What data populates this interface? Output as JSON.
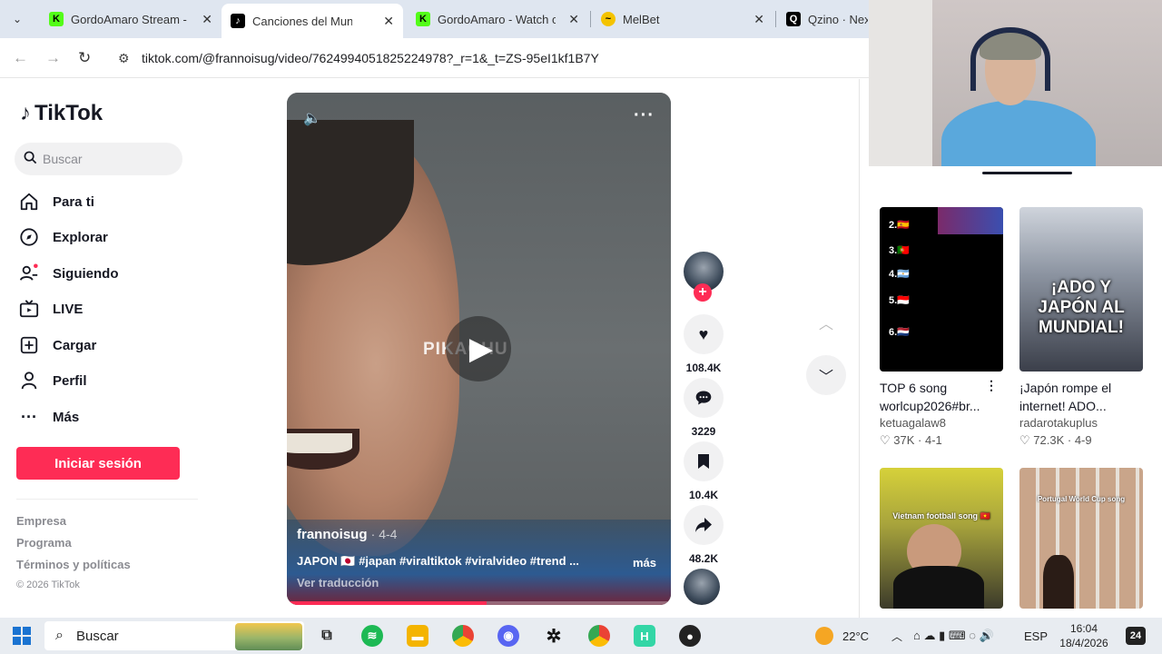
{
  "browser": {
    "tabs": [
      {
        "title": "GordoAmaro Stream - W",
        "favicon": "kick-icon",
        "color": "#53fc18"
      },
      {
        "title": "Canciones del Mundi",
        "favicon": "tiktok-icon",
        "color": "#000000"
      },
      {
        "title": "GordoAmaro - Watch cli",
        "favicon": "kick-icon",
        "color": "#53fc18"
      },
      {
        "title": "MelBet",
        "favicon": "melbet-icon",
        "color": "#f4c300"
      },
      {
        "title": "Qzino · Next-",
        "favicon": "qzino-icon",
        "color": "#000000"
      }
    ],
    "url": "tiktok.com/@frannoisug/video/7624994051825224978?_r=1&_t=ZS-95eI1kf1B7Y"
  },
  "sidebar": {
    "logo": "TikTok",
    "search_placeholder": "Buscar",
    "nav": [
      {
        "label": "Para ti",
        "icon": "home-icon"
      },
      {
        "label": "Explorar",
        "icon": "compass-icon"
      },
      {
        "label": "Siguiendo",
        "icon": "following-icon"
      },
      {
        "label": "LIVE",
        "icon": "live-tv-icon"
      },
      {
        "label": "Cargar",
        "icon": "upload-icon"
      },
      {
        "label": "Perfil",
        "icon": "profile-icon"
      },
      {
        "label": "Más",
        "icon": "more-icon"
      }
    ],
    "login_label": "Iniciar sesión",
    "footer_links": [
      "Empresa",
      "Programa",
      "Términos y políticas"
    ],
    "copyright": "© 2026 TikTok"
  },
  "video": {
    "watermark": "PIKACHU",
    "author": "frannoisug",
    "date": "· 4-4",
    "caption": "JAPON 🇯🇵 #japan #viraltiktok #viralvideo #trend ...",
    "more_label": "más",
    "translate_label": "Ver traducción",
    "progress": 0.52,
    "likes": "108.4K",
    "comments": "3229",
    "saves": "10.4K",
    "shares": "48.2K"
  },
  "related": [
    {
      "title": "TOP 6 song worlcup2026#br...",
      "user": "ketuagalaw8",
      "likes": "37K",
      "date": "4-1",
      "ranks": [
        "2.🇪🇸",
        "3.🇵🇹",
        "4.🇦🇷",
        "5.🇮🇩",
        "6.🇳🇱"
      ]
    },
    {
      "title": "¡Japón rompe el internet! ADO...",
      "user": "radarotakuplus",
      "likes": "72.3K",
      "date": "4-9",
      "thumb_text": "¡ADO Y JAPÓN AL MUNDIAL!"
    },
    {
      "thumb_text": "Vietnam football song 🇻🇳"
    },
    {
      "thumb_text": "Portugal  World Cup song"
    }
  ],
  "taskbar": {
    "search_label": "Buscar",
    "weather": "22°C",
    "language": "ESP",
    "time": "16:04",
    "date": "18/4/2026",
    "notifications": "24"
  }
}
